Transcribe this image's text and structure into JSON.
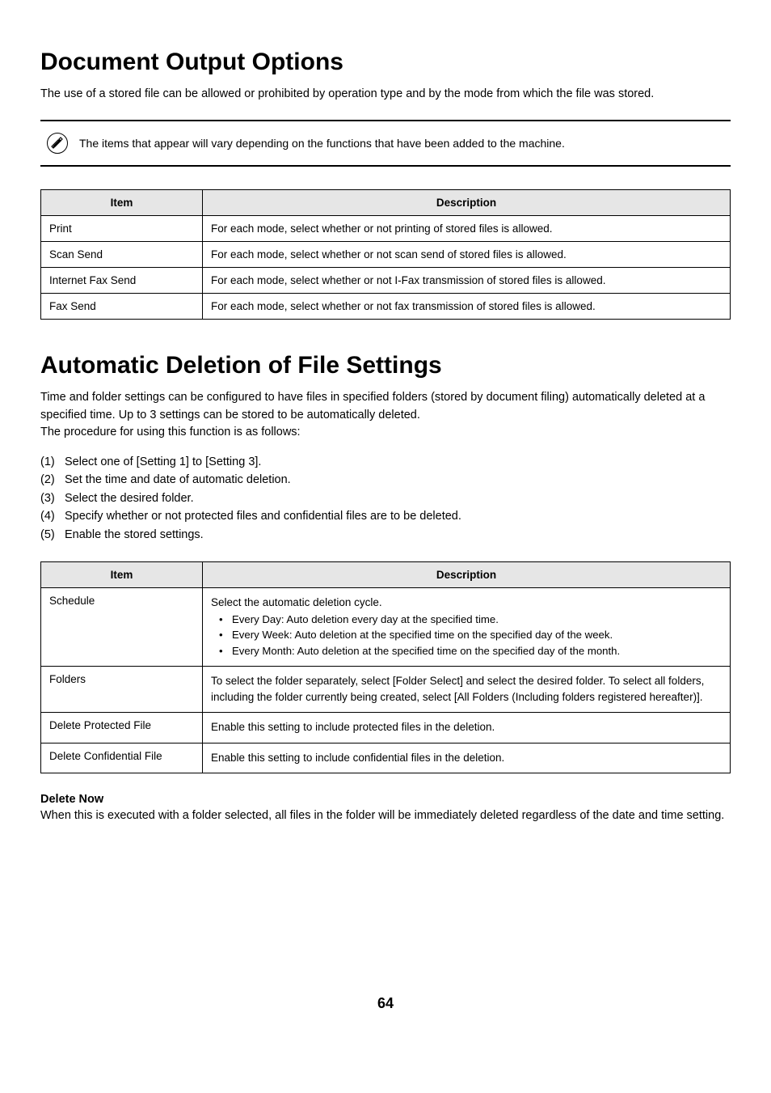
{
  "section1": {
    "heading": "Document Output Options",
    "intro": "The use of a stored file can be allowed or prohibited by operation type and by the mode from which the file was stored.",
    "note": "The items that appear will vary depending on the functions that have been added to the machine.",
    "table": {
      "headers": {
        "item": "Item",
        "desc": "Description"
      },
      "rows": [
        {
          "item": "Print",
          "desc": "For each mode, select whether or not printing of stored files is allowed."
        },
        {
          "item": "Scan Send",
          "desc": "For each mode, select whether or not scan send of stored files is allowed."
        },
        {
          "item": "Internet Fax Send",
          "desc": "For each mode, select whether or not I-Fax transmission of stored files is allowed."
        },
        {
          "item": "Fax Send",
          "desc": "For each mode, select whether or not fax transmission of stored files is allowed."
        }
      ]
    }
  },
  "section2": {
    "heading": "Automatic Deletion of File Settings",
    "intro": "Time and folder settings can be configured to have files in specified folders (stored by document filing) automatically deleted at a specified time. Up to 3 settings can be stored to be automatically deleted.\nThe procedure for using this function is as follows:",
    "procedure": [
      {
        "n": "(1)",
        "t": "Select one of [Setting 1] to [Setting 3]."
      },
      {
        "n": "(2)",
        "t": "Set the time and date of automatic deletion."
      },
      {
        "n": "(3)",
        "t": "Select the desired folder."
      },
      {
        "n": "(4)",
        "t": "Specify whether or not protected files and confidential files are to be deleted."
      },
      {
        "n": "(5)",
        "t": "Enable the stored settings."
      }
    ],
    "table": {
      "headers": {
        "item": "Item",
        "desc": "Description"
      },
      "rows": [
        {
          "item": "Schedule",
          "desc_intro": "Select the automatic deletion cycle.",
          "bullets": [
            "Every Day: Auto deletion every day at the specified time.",
            "Every Week: Auto deletion at the specified time on the specified day of the week.",
            "Every Month: Auto deletion at the specified time on the specified day of the month."
          ]
        },
        {
          "item": "Folders",
          "desc": "To select the folder separately, select [Folder Select] and select the desired folder. To select all folders, including the folder currently being created, select [All Folders (Including folders registered hereafter)]."
        },
        {
          "item": "Delete Protected File",
          "desc": "Enable this setting to include protected files in the deletion."
        },
        {
          "item": "Delete Confidential File",
          "desc": "Enable this setting to include confidential files in the deletion."
        }
      ]
    },
    "delete_now": {
      "title": "Delete Now",
      "body": "When this is executed with a folder selected, all files in the folder will be immediately deleted regardless of the date and time setting."
    }
  },
  "page_number": "64"
}
